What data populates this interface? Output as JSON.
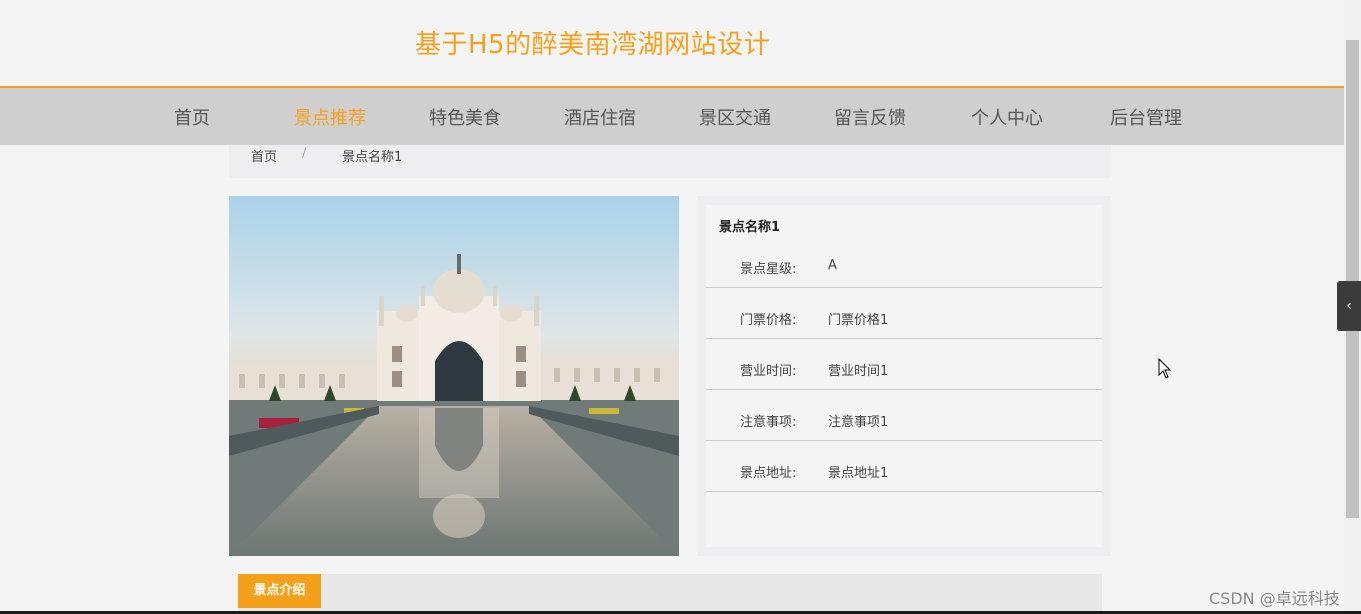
{
  "header": {
    "site_title": "基于H5的醉美南湾湖网站设计"
  },
  "nav": {
    "items": [
      {
        "label": "首页"
      },
      {
        "label": "景点推荐"
      },
      {
        "label": "特色美食"
      },
      {
        "label": "酒店住宿"
      },
      {
        "label": "景区交通"
      },
      {
        "label": "留言反馈"
      },
      {
        "label": "个人中心"
      },
      {
        "label": "后台管理"
      }
    ],
    "active_label": "景点推荐"
  },
  "breadcrumb": {
    "home": "首页",
    "separator": "/",
    "current": "景点名称1"
  },
  "detail": {
    "name": "景点名称1",
    "rows": [
      {
        "label": "景点星级:",
        "value": "A"
      },
      {
        "label": "门票价格:",
        "value": "门票价格1"
      },
      {
        "label": "营业时间:",
        "value": "营业时间1"
      },
      {
        "label": "注意事项:",
        "value": "注意事项1"
      },
      {
        "label": "景点地址:",
        "value": "景点地址1"
      }
    ]
  },
  "intro": {
    "tab_label": "景点介绍"
  },
  "side_toggle": {
    "icon": "chevron-left-icon",
    "glyph": "‹"
  },
  "watermark": "CSDN @卓远科技",
  "colors": {
    "accent": "#f5a01a",
    "nav_bg": "#cfcfcf",
    "page_bg": "#f4f4f4"
  }
}
